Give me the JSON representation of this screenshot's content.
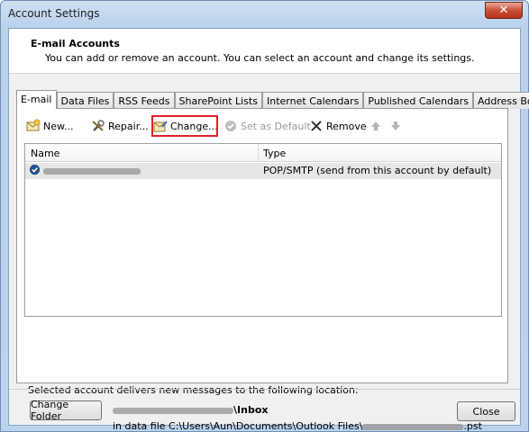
{
  "window": {
    "title": "Account Settings"
  },
  "header": {
    "title": "E-mail Accounts",
    "description": "You can add or remove an account. You can select an account and change its settings."
  },
  "tabs": [
    {
      "label": "E-mail",
      "active": true
    },
    {
      "label": "Data Files"
    },
    {
      "label": "RSS Feeds"
    },
    {
      "label": "SharePoint Lists"
    },
    {
      "label": "Internet Calendars"
    },
    {
      "label": "Published Calendars"
    },
    {
      "label": "Address Books"
    }
  ],
  "toolbar": {
    "new_label": "New...",
    "repair_label": "Repair...",
    "change_label": "Change...",
    "set_default_label": "Set as Default",
    "remove_label": "Remove"
  },
  "account_list": {
    "columns": [
      "Name",
      "Type"
    ],
    "rows": [
      {
        "type": "POP/SMTP (send from this account by default)"
      }
    ]
  },
  "delivery": {
    "label": "Selected account delivers new messages to the following location:",
    "change_folder_label": "Change Folder",
    "folder_suffix": "\\Inbox",
    "data_file_prefix": "in data file C:\\Users\\Aun\\Documents\\Outlook Files\\",
    "data_file_suffix": ".pst"
  },
  "footer": {
    "close_label": "Close"
  },
  "colors": {
    "highlight": "#e0202a",
    "selected_row": "#e6e6e6"
  }
}
